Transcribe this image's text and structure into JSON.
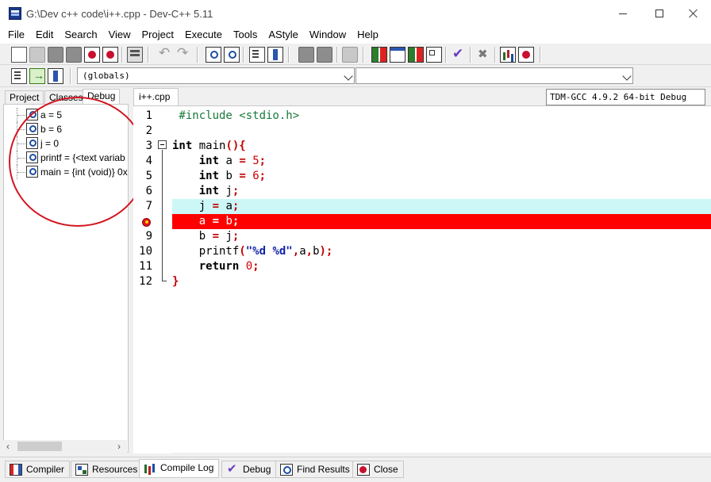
{
  "window": {
    "title": "G:\\Dev c++ code\\i++.cpp - Dev-C++ 5.11"
  },
  "menu": [
    "File",
    "Edit",
    "Search",
    "View",
    "Project",
    "Execute",
    "Tools",
    "AStyle",
    "Window",
    "Help"
  ],
  "toolbar": {
    "compiler": "TDM-GCC 4.9.2 64-bit Debug",
    "scope_combo": "(globals)",
    "members_combo": ""
  },
  "left_panel": {
    "tabs": [
      "Project",
      "Classes",
      "Debug"
    ],
    "active_tab": "Debug",
    "watches": [
      "a = 5",
      "b = 6",
      "j = 0",
      "printf = {<text variab",
      "main = {int (void)} 0x"
    ]
  },
  "editor": {
    "tab_label": "i++.cpp",
    "current_line": 7,
    "breakpoint_line": 8,
    "lines": [
      {
        "num": "1",
        "tokens": [
          {
            "t": " #include <stdio.h>",
            "c": "pp"
          }
        ]
      },
      {
        "num": "2",
        "tokens": []
      },
      {
        "num": "3",
        "tokens": [
          {
            "t": "int",
            "c": "kw"
          },
          {
            "t": " main",
            "c": "id"
          },
          {
            "t": "(){",
            "c": "sym"
          }
        ]
      },
      {
        "num": "4",
        "tokens": [
          {
            "t": "    ",
            "c": "id"
          },
          {
            "t": "int",
            "c": "kw"
          },
          {
            "t": " a ",
            "c": "id"
          },
          {
            "t": "=",
            "c": "sym"
          },
          {
            "t": " ",
            "c": "id"
          },
          {
            "t": "5",
            "c": "num"
          },
          {
            "t": ";",
            "c": "sym"
          }
        ]
      },
      {
        "num": "5",
        "tokens": [
          {
            "t": "    ",
            "c": "id"
          },
          {
            "t": "int",
            "c": "kw"
          },
          {
            "t": " b ",
            "c": "id"
          },
          {
            "t": "=",
            "c": "sym"
          },
          {
            "t": " ",
            "c": "id"
          },
          {
            "t": "6",
            "c": "num"
          },
          {
            "t": ";",
            "c": "sym"
          }
        ]
      },
      {
        "num": "6",
        "tokens": [
          {
            "t": "    ",
            "c": "id"
          },
          {
            "t": "int",
            "c": "kw"
          },
          {
            "t": " j",
            "c": "id"
          },
          {
            "t": ";",
            "c": "sym"
          }
        ]
      },
      {
        "num": "7",
        "tokens": [
          {
            "t": "    j ",
            "c": "id"
          },
          {
            "t": "=",
            "c": "sym"
          },
          {
            "t": " a",
            "c": "id"
          },
          {
            "t": ";",
            "c": "sym"
          }
        ]
      },
      {
        "num": "",
        "tokens": [
          {
            "t": "    a ",
            "c": "id"
          },
          {
            "t": "=",
            "c": "sym"
          },
          {
            "t": " b",
            "c": "id"
          },
          {
            "t": ";",
            "c": "sym"
          }
        ]
      },
      {
        "num": "9",
        "tokens": [
          {
            "t": "    b ",
            "c": "id"
          },
          {
            "t": "=",
            "c": "sym"
          },
          {
            "t": " j",
            "c": "id"
          },
          {
            "t": ";",
            "c": "sym"
          }
        ]
      },
      {
        "num": "10",
        "tokens": [
          {
            "t": "    printf",
            "c": "id"
          },
          {
            "t": "(",
            "c": "sym"
          },
          {
            "t": "\"%d %d\"",
            "c": "str"
          },
          {
            "t": ",",
            "c": "sym"
          },
          {
            "t": "a",
            "c": "id"
          },
          {
            "t": ",",
            "c": "sym"
          },
          {
            "t": "b",
            "c": "id"
          },
          {
            "t": ");",
            "c": "sym"
          }
        ]
      },
      {
        "num": "11",
        "tokens": [
          {
            "t": "    ",
            "c": "id"
          },
          {
            "t": "return",
            "c": "kw"
          },
          {
            "t": " ",
            "c": "id"
          },
          {
            "t": "0",
            "c": "num"
          },
          {
            "t": ";",
            "c": "sym"
          }
        ]
      },
      {
        "num": "12",
        "tokens": [
          {
            "t": "}",
            "c": "sym"
          }
        ]
      }
    ]
  },
  "bottom_tabs": [
    "Compiler",
    "Resources",
    "Compile Log",
    "Debug",
    "Find Results",
    "Close"
  ],
  "bottom_active": "Compile Log",
  "colors": {
    "current_line_bg": "#cdf7f7",
    "breakpoint_bg": "#ff0000",
    "annotation": "#d2141f"
  }
}
